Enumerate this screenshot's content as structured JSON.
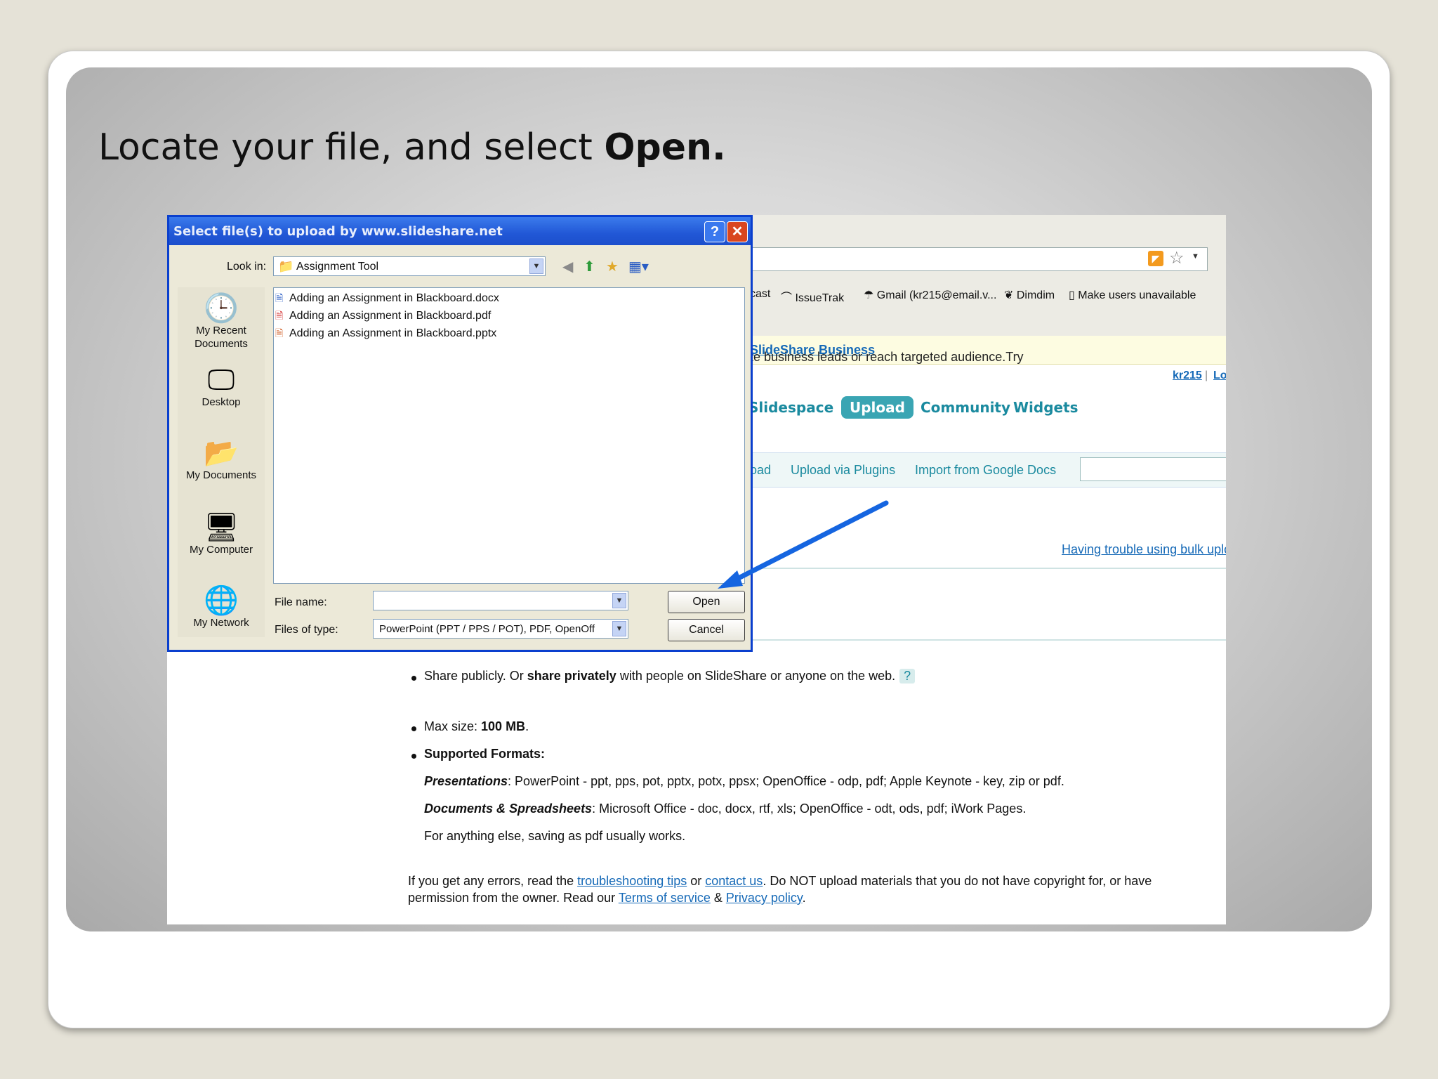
{
  "slide": {
    "heading_prefix": "Locate your file, and select ",
    "heading_bold": "Open."
  },
  "dialog": {
    "title": "Select file(s) to upload by www.slideshare.net",
    "help_glyph": "?",
    "close_glyph": "✕",
    "look_in_label": "Look in:",
    "look_in_value": "Assignment Tool",
    "places": [
      {
        "label": "My Recent Documents",
        "icon": "recent-documents-icon"
      },
      {
        "label": "Desktop",
        "icon": "desktop-icon"
      },
      {
        "label": "My Documents",
        "icon": "my-documents-icon"
      },
      {
        "label": "My Computer",
        "icon": "my-computer-icon"
      },
      {
        "label": "My Network",
        "icon": "my-network-icon"
      }
    ],
    "files": [
      {
        "name": "Adding an Assignment in Blackboard.docx",
        "type": "docx"
      },
      {
        "name": "Adding an Assignment in Blackboard.pdf",
        "type": "pdf"
      },
      {
        "name": "Adding an Assignment in Blackboard.pptx",
        "type": "pptx"
      }
    ],
    "file_name_label": "File name:",
    "file_name_value": "",
    "files_of_type_label": "Files of type:",
    "files_of_type_value": "PowerPoint (PPT / PPS / POT), PDF, OpenOff",
    "open_label": "Open",
    "cancel_label": "Cancel"
  },
  "browser": {
    "bookmarks": [
      "cast",
      "IssueTrak",
      "Gmail (kr215@email.v...",
      "Dimdim",
      "Make users unavailable"
    ],
    "banner_text": "te business leads or reach targeted audience.Try ",
    "banner_link": "SlideShare Business",
    "banner_end": ".",
    "user_link": "kr215",
    "user_sep": "|",
    "user_link2": "Lo",
    "nav": [
      "Slidespace",
      "Upload",
      "Community",
      "Widgets"
    ],
    "subnav": [
      "oad",
      "Upload via Plugins",
      "Import from Google Docs"
    ],
    "trouble_link": "Having trouble using bulk uplo"
  },
  "info": {
    "share_pre": "Share publicly. Or ",
    "share_bold": "share privately",
    "share_post": " with people on SlideShare or anyone on the web.",
    "share_q": "?",
    "max_pre": "Max size: ",
    "max_bold": "100 MB",
    "max_post": ".",
    "formats_title": "Supported Formats:",
    "pres_label": "Presentations",
    "pres_text": ": PowerPoint - ppt, pps, pot, pptx, potx, ppsx; OpenOffice - odp, pdf; Apple Keynote - key, zip or pdf.",
    "docs_label": "Documents & Spreadsheets",
    "docs_text": ": Microsoft Office - doc, docx, rtf, xls; OpenOffice - odt, ods, pdf; iWork Pages.",
    "else_text": "For anything else, saving as pdf usually works.",
    "errors_pre": "If you get any errors, read the ",
    "errors_link1": "troubleshooting tips",
    "errors_mid1": " or ",
    "errors_link2": "contact us",
    "errors_post": ". Do NOT upload materials that you do not have copyright for, or have",
    "perm_pre": "permission from the owner. Read our ",
    "perm_link1": "Terms of service",
    "perm_mid": " & ",
    "perm_link2": "Privacy policy",
    "perm_post": "."
  },
  "colors": {
    "arrow": "#1565e0",
    "titlebar": "#2157d6",
    "nav_teal": "#1a8a9f"
  }
}
